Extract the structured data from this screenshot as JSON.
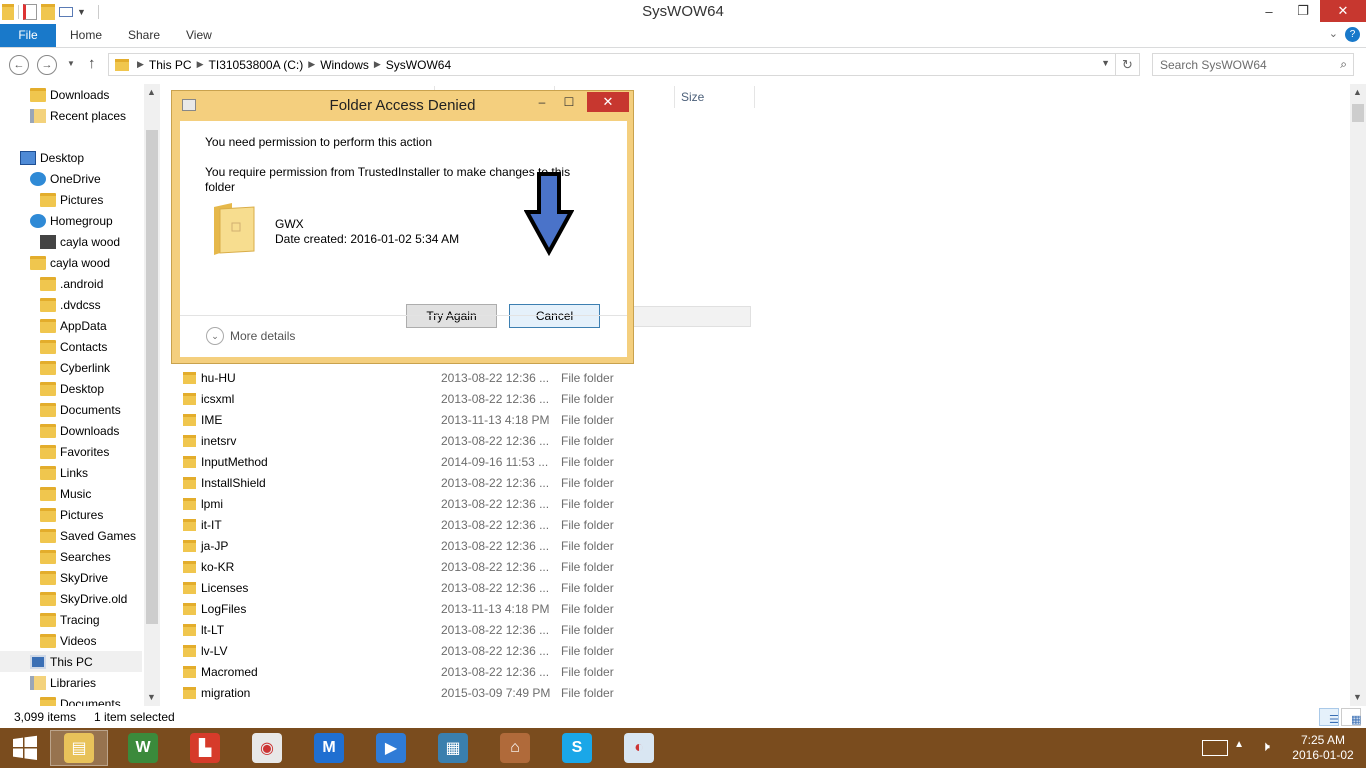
{
  "window": {
    "title": "SysWOW64",
    "minimize_glyph": "–",
    "restore_glyph": "❐",
    "close_glyph": "✕"
  },
  "ribbon": {
    "tabs": [
      "File",
      "Home",
      "Share",
      "View"
    ],
    "expand_glyph": "⌄",
    "help_glyph": "?"
  },
  "address": {
    "crumbs": [
      "This PC",
      "TI31053800A (C:)",
      "Windows",
      "SysWOW64"
    ],
    "search_placeholder": "Search SysWOW64"
  },
  "nav_pane": {
    "items": [
      {
        "label": "Downloads",
        "icon": "folder-icon"
      },
      {
        "label": "Recent places",
        "icon": "recent-icon"
      },
      {
        "label": "Desktop",
        "icon": "desktop-icon"
      },
      {
        "label": "OneDrive",
        "icon": "cloud-icon"
      },
      {
        "label": "Pictures",
        "icon": "folder-icon"
      },
      {
        "label": "Homegroup",
        "icon": "homegroup-icon"
      },
      {
        "label": "cayla wood",
        "icon": "user-icon"
      },
      {
        "label": "cayla wood",
        "icon": "folder-icon"
      },
      {
        "label": ".android",
        "icon": "folder-icon"
      },
      {
        "label": ".dvdcss",
        "icon": "folder-icon"
      },
      {
        "label": "AppData",
        "icon": "folder-icon"
      },
      {
        "label": "Contacts",
        "icon": "folder-icon"
      },
      {
        "label": "Cyberlink",
        "icon": "folder-icon"
      },
      {
        "label": "Desktop",
        "icon": "folder-icon"
      },
      {
        "label": "Documents",
        "icon": "folder-icon"
      },
      {
        "label": "Downloads",
        "icon": "folder-icon"
      },
      {
        "label": "Favorites",
        "icon": "folder-icon"
      },
      {
        "label": "Links",
        "icon": "folder-icon"
      },
      {
        "label": "Music",
        "icon": "folder-icon"
      },
      {
        "label": "Pictures",
        "icon": "folder-icon"
      },
      {
        "label": "Saved Games",
        "icon": "folder-icon"
      },
      {
        "label": "Searches",
        "icon": "folder-icon"
      },
      {
        "label": "SkyDrive",
        "icon": "folder-icon"
      },
      {
        "label": "SkyDrive.old",
        "icon": "folder-icon"
      },
      {
        "label": "Tracing",
        "icon": "folder-icon"
      },
      {
        "label": "Videos",
        "icon": "folder-icon"
      },
      {
        "label": "This PC",
        "icon": "computer-icon"
      },
      {
        "label": "Libraries",
        "icon": "library-icon"
      },
      {
        "label": "Documents",
        "icon": "folder-icon"
      }
    ]
  },
  "columns": {
    "size": "Size"
  },
  "files": [
    {
      "name": "hu-HU",
      "date": "2013-08-22 12:36 ...",
      "type": "File folder"
    },
    {
      "name": "icsxml",
      "date": "2013-08-22 12:36 ...",
      "type": "File folder"
    },
    {
      "name": "IME",
      "date": "2013-11-13 4:18 PM",
      "type": "File folder"
    },
    {
      "name": "inetsrv",
      "date": "2013-08-22 12:36 ...",
      "type": "File folder"
    },
    {
      "name": "InputMethod",
      "date": "2014-09-16 11:53 ...",
      "type": "File folder"
    },
    {
      "name": "InstallShield",
      "date": "2013-08-22 12:36 ...",
      "type": "File folder"
    },
    {
      "name": "lpmi",
      "date": "2013-08-22 12:36 ...",
      "type": "File folder"
    },
    {
      "name": "it-IT",
      "date": "2013-08-22 12:36 ...",
      "type": "File folder"
    },
    {
      "name": "ja-JP",
      "date": "2013-08-22 12:36 ...",
      "type": "File folder"
    },
    {
      "name": "ko-KR",
      "date": "2013-08-22 12:36 ...",
      "type": "File folder"
    },
    {
      "name": "Licenses",
      "date": "2013-08-22 12:36 ...",
      "type": "File folder"
    },
    {
      "name": "LogFiles",
      "date": "2013-11-13 4:18 PM",
      "type": "File folder"
    },
    {
      "name": "lt-LT",
      "date": "2013-08-22 12:36 ...",
      "type": "File folder"
    },
    {
      "name": "lv-LV",
      "date": "2013-08-22 12:36 ...",
      "type": "File folder"
    },
    {
      "name": "Macromed",
      "date": "2013-08-22 12:36 ...",
      "type": "File folder"
    },
    {
      "name": "migration",
      "date": "2015-03-09 7:49 PM",
      "type": "File folder"
    }
  ],
  "status": {
    "item_count": "3,099 items",
    "selection": "1 item selected"
  },
  "dialog": {
    "title": "Folder Access Denied",
    "heading": "You need permission to perform this action",
    "message": "You require permission from TrustedInstaller to make changes to this folder",
    "folder_name": "GWX",
    "folder_date": "Date created: 2016-01-02 5:34 AM",
    "try_again_label": "Try Again",
    "cancel_label": "Cancel",
    "more_details_label": "More details",
    "close_glyph": "✕"
  },
  "taskbar": {
    "apps": [
      {
        "name": "file-explorer",
        "color": "#e8c25a"
      },
      {
        "name": "wordperfect",
        "color": "#3b8a3b"
      },
      {
        "name": "colorful-app",
        "color": "#d63b2a"
      },
      {
        "name": "chrome",
        "color": "#e8e8e8"
      },
      {
        "name": "malwarebytes",
        "color": "#1f6fd1"
      },
      {
        "name": "media-player",
        "color": "#2f7bd6"
      },
      {
        "name": "video-app",
        "color": "#3a7fae"
      },
      {
        "name": "store-app",
        "color": "#b06a3a"
      },
      {
        "name": "skype",
        "color": "#1aa7e8"
      },
      {
        "name": "paint",
        "color": "#d9e6f2"
      }
    ],
    "time": "7:25 AM",
    "date": "2016-01-02"
  },
  "colors": {
    "file_tab": "#1979ca",
    "close_red": "#c7372f",
    "dialog_frame": "#f4cf7e",
    "taskbar": "#7a4c1e",
    "arrow_fill": "#4a73c9"
  }
}
